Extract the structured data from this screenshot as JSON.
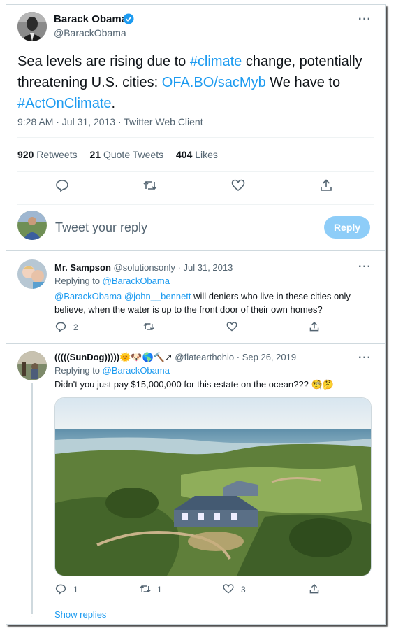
{
  "main_tweet": {
    "author_name": "Barack Obama",
    "handle": "@BarackObama",
    "text_parts": [
      "Sea levels are rising due to ",
      "#climate",
      " change, potentially threatening U.S. cities: ",
      "OFA.BO/sacMyb",
      " We have to ",
      "#ActOnClimate",
      "."
    ],
    "meta": "9:28 AM · Jul 31, 2013 · Twitter Web Client",
    "retweets_count": "920",
    "retweets_label": "Retweets",
    "quotes_count": "21",
    "quotes_label": "Quote Tweets",
    "likes_count": "404",
    "likes_label": "Likes"
  },
  "composer": {
    "placeholder": "Tweet your reply",
    "button_label": "Reply"
  },
  "reply1": {
    "name": "Mr. Sampson",
    "handle": "@solutionsonly",
    "dot": "·",
    "date": "Jul 31, 2013",
    "replying_prefix": "Replying to ",
    "replying_to": "@BarackObama",
    "mention1": "@BarackObama",
    "mention2": "@john__bennett",
    "text": " will deniers who live in these cities only believe, when the water is up to the front door of their own homes?",
    "reply_count": "2",
    "retweet_count": "",
    "like_count": ""
  },
  "reply2": {
    "name": "(((((SunDog)))))",
    "emojis": "🌞🐶🌎🔨↗",
    "handle": "@flatearthohio",
    "dot": "·",
    "date": "Sep 26, 2019",
    "replying_prefix": "Replying to ",
    "replying_to": "@BarackObama",
    "text": "Didn't you just pay $15,000,000 for this estate on the ocean??? 🧐🤔",
    "reply_count": "1",
    "retweet_count": "1",
    "like_count": "3",
    "show_replies": "Show replies"
  },
  "colors": {
    "accent": "#1d9bf0",
    "verified": "#1d9bf0",
    "muted": "#536471",
    "reply_button_bg": "#8ecdf8"
  },
  "icons": [
    "verified-badge-icon",
    "more-icon",
    "reply-icon",
    "retweet-icon",
    "like-icon",
    "share-icon"
  ]
}
